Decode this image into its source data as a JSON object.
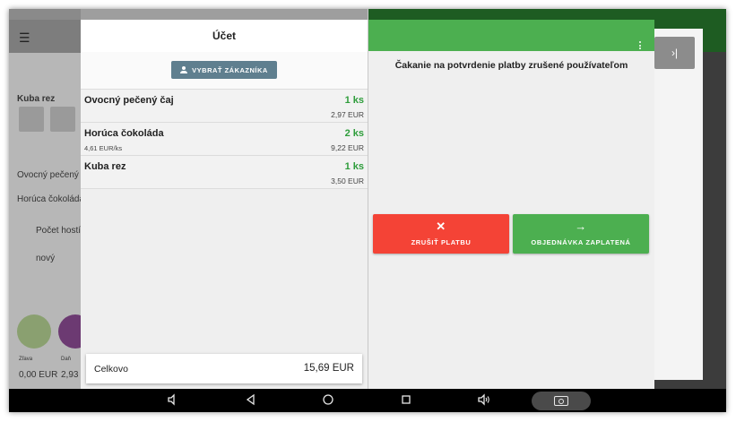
{
  "background": {
    "customer_label": "Kuba rez",
    "order_items": [
      "Ovocný pečený čaj",
      "Horúca čokoláda"
    ],
    "guests_label": "Počet hostí",
    "new_label": "nový",
    "discount_label": "Zľava",
    "tax_label": "Daň",
    "discount_value": "0,00 EUR",
    "tax_value": "2,93",
    "next_glyph": "›|"
  },
  "bill": {
    "title": "Účet",
    "select_customer_label": "VYBRAŤ ZÁKAZNÍKA",
    "items": [
      {
        "name": "Ovocný pečený čaj",
        "qty": "1 ks",
        "unit_price": "",
        "price": "2,97 EUR"
      },
      {
        "name": "Horúca čokoláda",
        "qty": "2 ks",
        "unit_price": "4,61 EUR/ks",
        "price": "9,22 EUR"
      },
      {
        "name": "Kuba rez",
        "qty": "1 ks",
        "unit_price": "",
        "price": "3,50 EUR"
      }
    ],
    "total_label": "Celkovo",
    "total_value": "15,69 EUR"
  },
  "payment": {
    "message": "Čakanie na potvrdenie platby zrušené používateľom",
    "cancel_label": "ZRUŠIŤ PLATBU",
    "cancel_glyph": "✕",
    "paid_label": "OBJEDNÁVKA ZAPLATENÁ",
    "paid_glyph": "→"
  },
  "colors": {
    "green": "#4caf50",
    "red": "#f44336",
    "customer_button": "#5f7f8f",
    "quantity_green": "#2e9d3b"
  },
  "icons": [
    "menu-icon",
    "person-icon",
    "more-vert-icon",
    "close-icon",
    "arrow-right-icon",
    "back-icon",
    "home-icon",
    "recents-icon",
    "volume-down-icon",
    "volume-up-icon",
    "camera-icon"
  ]
}
